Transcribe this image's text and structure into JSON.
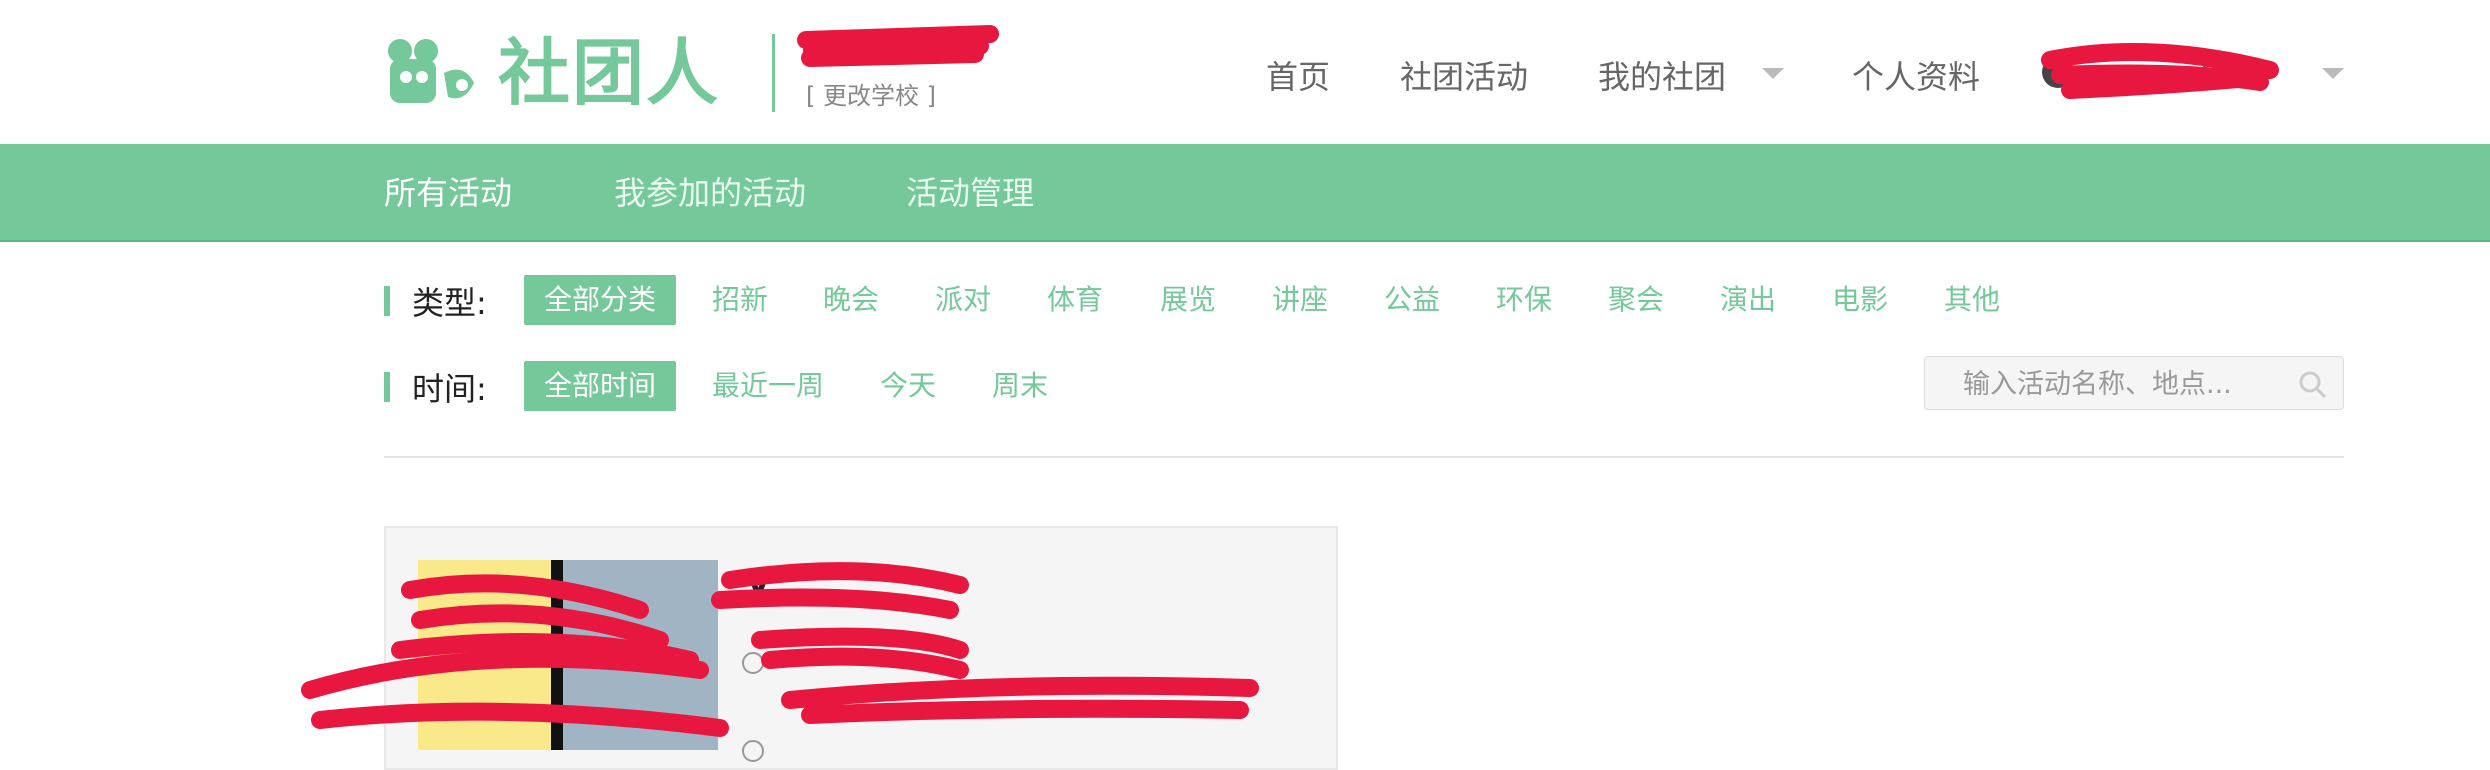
{
  "brand": {
    "logo_text": "社团人",
    "school_name": "",
    "change_school": "[ 更改学校 ]",
    "color": "#74c899"
  },
  "topnav": {
    "items": [
      {
        "label": "首页"
      },
      {
        "label": "社团活动"
      },
      {
        "label": "我的社团",
        "dropdown": true
      },
      {
        "label": "个人资料"
      }
    ],
    "username": "h.."
  },
  "subnav": {
    "items": [
      {
        "label": "所有活动",
        "active": true
      },
      {
        "label": "我参加的活动"
      },
      {
        "label": "活动管理"
      }
    ]
  },
  "filters": {
    "type_label": "类型:",
    "types": [
      "全部分类",
      "招新",
      "晚会",
      "派对",
      "体育",
      "展览",
      "讲座",
      "公益",
      "环保",
      "聚会",
      "演出",
      "电影",
      "其他"
    ],
    "type_selected": "全部分类",
    "time_label": "时间:",
    "times": [
      "全部时间",
      "最近一周",
      "今天",
      "周末"
    ],
    "time_selected": "全部时间"
  },
  "search": {
    "placeholder": "输入活动名称、地点..."
  },
  "card": {
    "poster_text": "",
    "title": "V",
    "meta": [
      "",
      "",
      ""
    ]
  }
}
